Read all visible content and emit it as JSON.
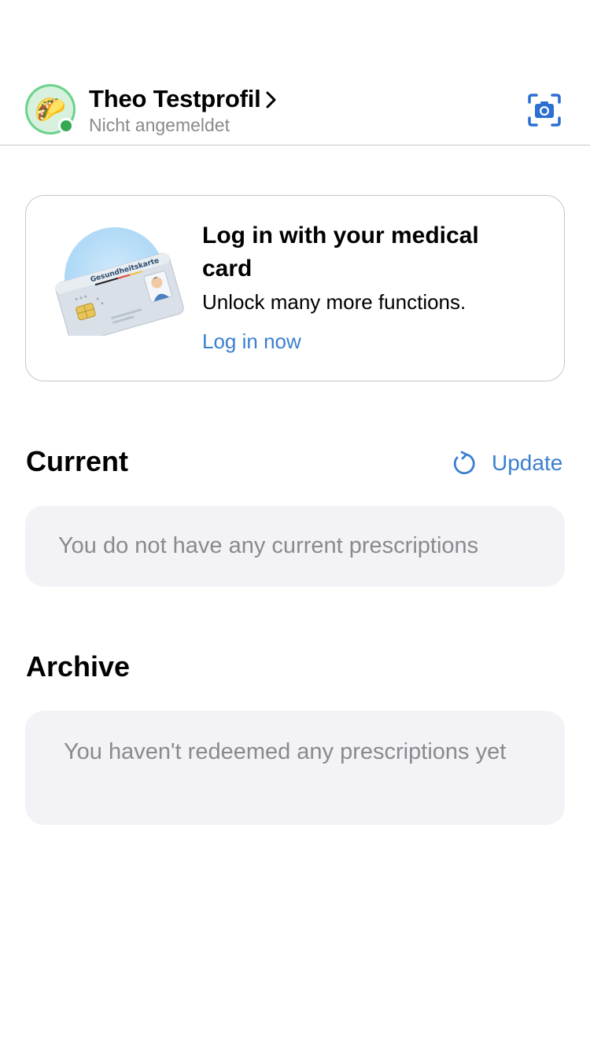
{
  "header": {
    "profile_name": "Theo Testprofil",
    "profile_status": "Nicht angemeldet",
    "avatar_emoji": "🌮",
    "status_color": "#34a853"
  },
  "login_card": {
    "title": "Log in with your medical card",
    "subtitle": "Unlock many more functions.",
    "link": "Log in now",
    "card_text": "Gesundheitskarte"
  },
  "current": {
    "title": "Current",
    "update_label": "Update",
    "empty_message": "You do not have any current prescriptions"
  },
  "archive": {
    "title": "Archive",
    "empty_message": "You haven't redeemed any prescriptions yet"
  },
  "colors": {
    "accent": "#3b7fd0",
    "empty_bg": "#f2f2f7"
  }
}
